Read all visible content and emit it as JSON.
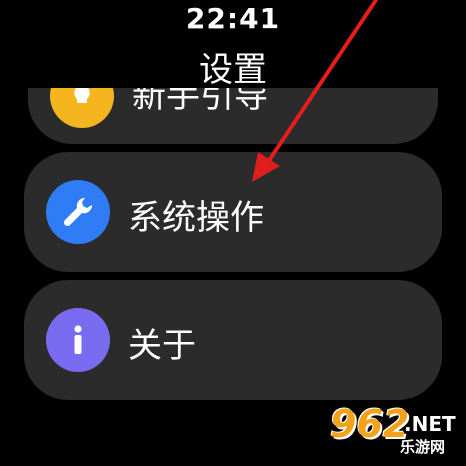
{
  "status": {
    "time": "22:41"
  },
  "header": {
    "title": "设置"
  },
  "menu": {
    "items": [
      {
        "label": "新手引导",
        "icon": "lightbulb-icon",
        "color": "#f5b51f"
      },
      {
        "label": "系统操作",
        "icon": "wrench-icon",
        "color": "#2f7cf6"
      },
      {
        "label": "关于",
        "icon": "info-icon",
        "color": "#7a6cf0"
      }
    ]
  },
  "colors": {
    "background": "#000000",
    "card": "#2b2b2b",
    "arrow": "#e01e1e"
  },
  "watermark": {
    "number": "962",
    "net": ".NET",
    "sub": "乐游网"
  }
}
